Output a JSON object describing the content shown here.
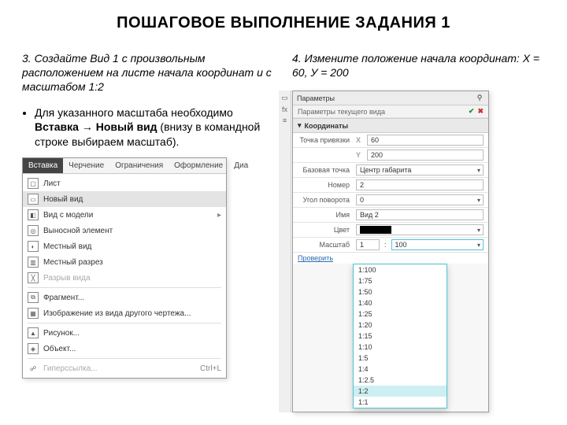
{
  "title": "ПОШАГОВОЕ ВЫПОЛНЕНИЕ ЗАДАНИЯ 1",
  "left": {
    "step_heading": "3. Создайте Вид 1 с произвольным расположением на листе начала координат и с масштабом 1:2",
    "bullet_pre": "Для указанного масштаба необходимо ",
    "bullet_bold": "Вставка → Новый вид",
    "bullet_post": " (внизу в командной строке выбираем масштаб)."
  },
  "menu": {
    "tabs": [
      "Вставка",
      "Черчение",
      "Ограничения",
      "Оформление",
      "Диа"
    ],
    "items": [
      {
        "label": "Лист",
        "disabled": false
      },
      {
        "label": "Новый вид",
        "hl": true
      },
      {
        "label": "Вид с модели",
        "sub": true
      },
      {
        "label": "Выносной элемент",
        "sub": false
      },
      {
        "label": "Местный вид"
      },
      {
        "label": "Местный разрез"
      },
      {
        "label": "Разрыв вида",
        "disabled": true
      },
      {
        "label": "Фрагмент...",
        "sep_before": true
      },
      {
        "label": "Изображение из вида другого чертежа..."
      },
      {
        "label": "Рисунок...",
        "sep_before": true
      },
      {
        "label": "Объект..."
      },
      {
        "label": "Гиперссылка...",
        "disabled": true,
        "shortcut": "Ctrl+L",
        "sep_before": true
      }
    ]
  },
  "right": {
    "step_heading": "4. Измените положение начала координат: Х = 60, У = 200"
  },
  "panel": {
    "title": "Параметры",
    "subtitle": "Параметры текущего вида",
    "section": "Координаты",
    "coord_point_label": "Точка привязки",
    "x_lab": "X",
    "x_val": "60",
    "y_lab": "Y",
    "y_val": "200",
    "base_label": "Базовая точка",
    "base_val": "Центр габарита",
    "num_label": "Номер",
    "num_val": "2",
    "angle_label": "Угол поворота",
    "angle_val": "0",
    "name_label": "Имя",
    "name_val": "Вид 2",
    "color_label": "Цвет",
    "scale_label": "Масштаб",
    "scale_left": "1",
    "scale_right": "100",
    "link": "Проверить",
    "options": [
      "1:100",
      "1:75",
      "1:50",
      "1:40",
      "1:25",
      "1:20",
      "1:15",
      "1:10",
      "1:5",
      "1:4",
      "1:2.5",
      "1:2",
      "1:1"
    ],
    "selected_opt": "1:2"
  }
}
